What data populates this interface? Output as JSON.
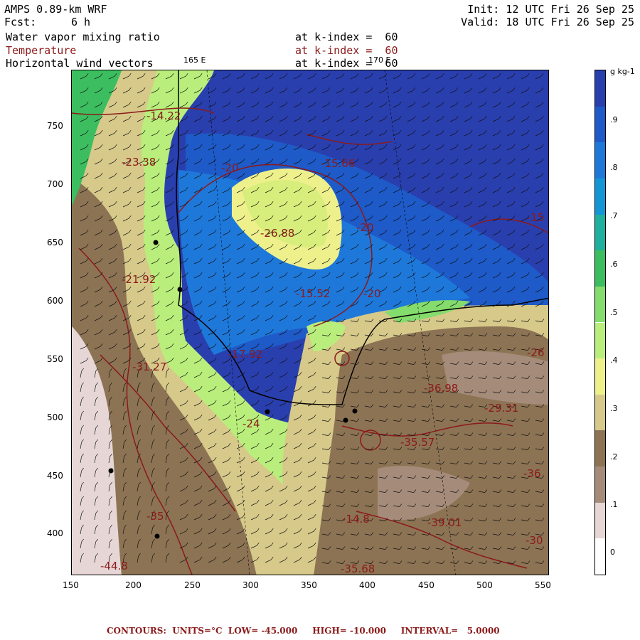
{
  "header": {
    "model": "AMPS 0.89-km WRF",
    "forecast_label": "Fcst:",
    "forecast_value": "6 h",
    "init": "Init: 12 UTC Fri 26 Sep 25",
    "valid": "Valid: 18 UTC Fri 26 Sep 25",
    "fields": [
      {
        "name": "Water vapor mixing ratio",
        "level": "at k-index =  60",
        "color": "#000000"
      },
      {
        "name": "Temperature",
        "level": "at k-index =  60",
        "color": "#8b1a1a"
      },
      {
        "name": "Horizontal wind vectors",
        "level": "at k-index =  60",
        "color": "#000000"
      }
    ],
    "lon_labels": [
      "165 E",
      "170 E"
    ]
  },
  "axes": {
    "x_ticks": [
      "150",
      "200",
      "250",
      "300",
      "350",
      "400",
      "450",
      "500",
      "550"
    ],
    "y_ticks": [
      "750",
      "700",
      "650",
      "600",
      "550",
      "500",
      "450",
      "400"
    ]
  },
  "colorbar": {
    "unit": "g kg-1",
    "labels": [
      ".9",
      ".8",
      ".7",
      ".6",
      ".5",
      ".4",
      ".3",
      ".2",
      ".1",
      "0"
    ],
    "colors": [
      "#ffffff",
      "#e6d7d6",
      "#a58c7a",
      "#8c7354",
      "#d6c98a",
      "#eef08c",
      "#b9ee7c",
      "#84dc6c",
      "#3cbe60",
      "#1eb09c",
      "#1496d6",
      "#1e78da",
      "#1e5ac8",
      "#2a3fae"
    ]
  },
  "contour_labels": [
    {
      "text": "-14.22",
      "color": "#8b1a1a"
    },
    {
      "text": "-23.38",
      "color": "#8b1a1a"
    },
    {
      "text": "-20",
      "color": "#8b1a1a"
    },
    {
      "text": "-15.66",
      "color": "#8b1a1a"
    },
    {
      "text": "-26.88",
      "color": "#8b1a1a"
    },
    {
      "text": "-20",
      "color": "#8b1a1a"
    },
    {
      "text": "-15.52",
      "color": "#8b1a1a"
    },
    {
      "text": "-20",
      "color": "#8b1a1a"
    },
    {
      "text": "-15",
      "color": "#8b1a1a"
    },
    {
      "text": "-21.92",
      "color": "#8b1a1a"
    },
    {
      "text": "-17.92",
      "color": "#8b1a1a"
    },
    {
      "text": "-31.27",
      "color": "#8b1a1a"
    },
    {
      "text": "-36.98",
      "color": "#8b1a1a"
    },
    {
      "text": "-29.31",
      "color": "#8b1a1a"
    },
    {
      "text": "-35.57",
      "color": "#8b1a1a"
    },
    {
      "text": "-24",
      "color": "#8b1a1a"
    },
    {
      "text": "-14.8",
      "color": "#8b1a1a"
    },
    {
      "text": "-39.01",
      "color": "#8b1a1a"
    },
    {
      "text": "-35.68",
      "color": "#8b1a1a"
    },
    {
      "text": "-44.8",
      "color": "#8b1a1a"
    },
    {
      "text": "-26",
      "color": "#8b1a1a"
    },
    {
      "text": "-36",
      "color": "#8b1a1a"
    },
    {
      "text": "-30",
      "color": "#8b1a1a"
    },
    {
      "text": "-35",
      "color": "#8b1a1a"
    }
  ],
  "footer": "CONTOURS:  UNITS=°C  LOW= -45.000     HIGH= -10.000     INTERVAL=   5.0000"
}
